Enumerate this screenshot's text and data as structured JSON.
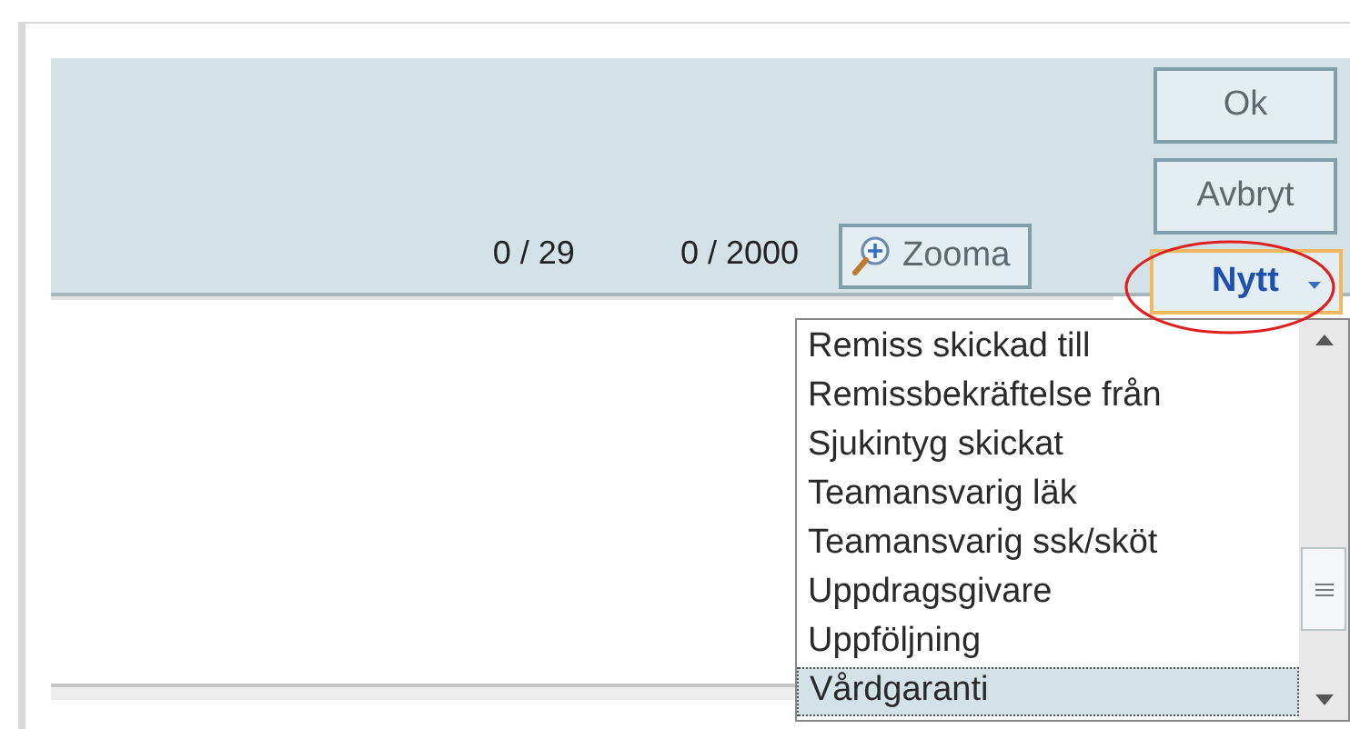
{
  "buttons": [
    {
      "label": "Ok",
      "kind": "plain"
    },
    {
      "label": "Avbryt",
      "kind": "plain"
    },
    {
      "label": "Nytt",
      "kind": "menu",
      "highlighted": true
    }
  ],
  "counters": [
    "0 / 29",
    "0 / 2000"
  ],
  "zoom_button": {
    "label": "Zooma"
  },
  "dropdown": {
    "items": [
      {
        "label": "Remiss skickad till",
        "selected": false
      },
      {
        "label": "Remissbekräftelse från",
        "selected": false
      },
      {
        "label": "Sjukintyg skickat",
        "selected": false
      },
      {
        "label": "Teamansvarig läk",
        "selected": false
      },
      {
        "label": "Teamansvarig ssk/sköt",
        "selected": false
      },
      {
        "label": "Uppdragsgivare",
        "selected": false
      },
      {
        "label": "Uppföljning",
        "selected": false
      },
      {
        "label": "Vårdgaranti",
        "selected": true
      }
    ]
  }
}
